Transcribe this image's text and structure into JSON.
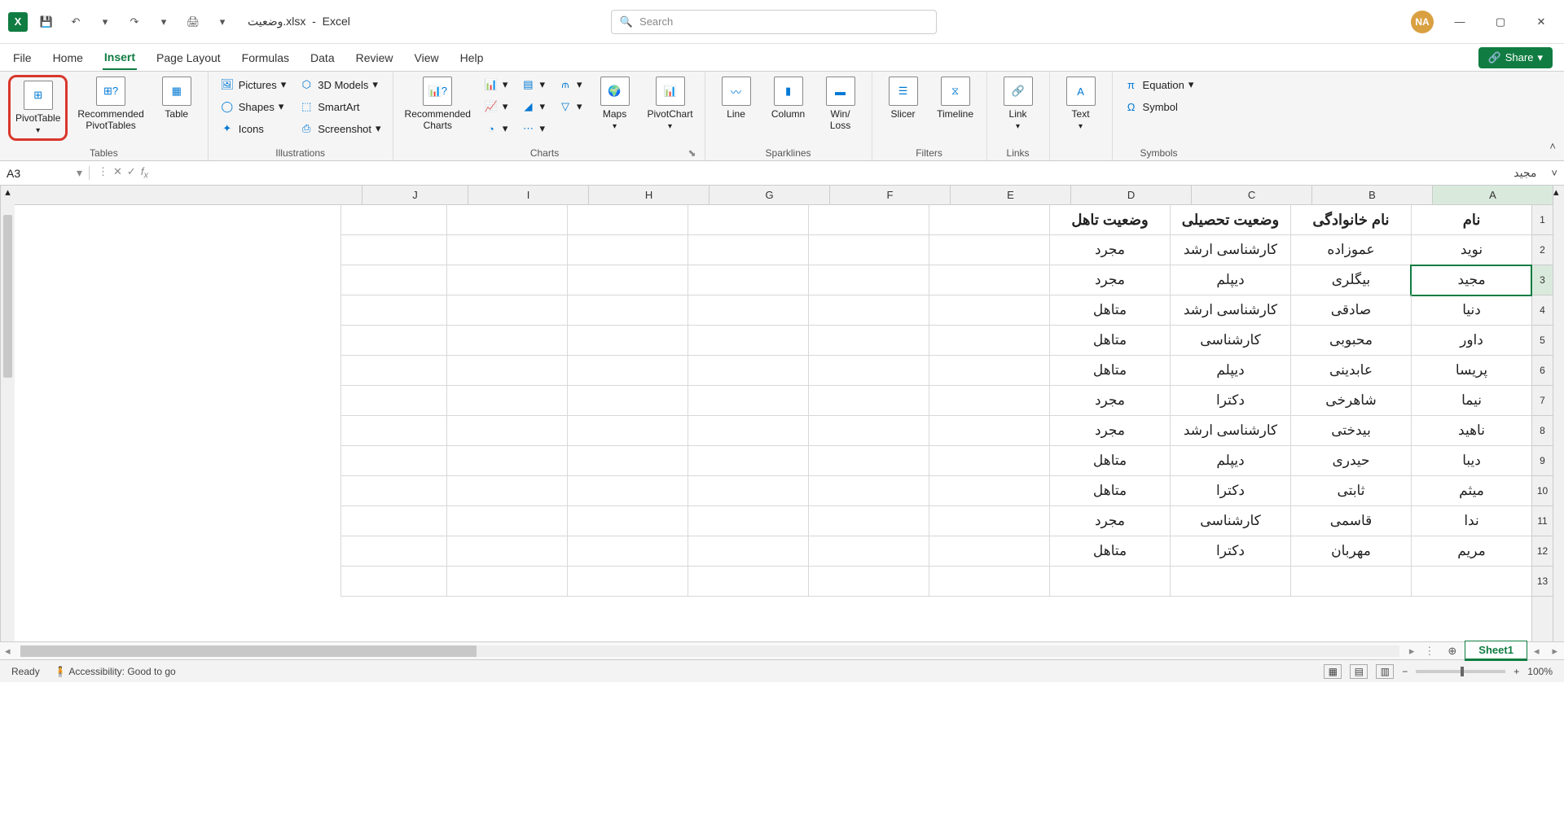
{
  "app": {
    "filename": "وضعیت.xlsx",
    "appname": "Excel",
    "avatar": "NA"
  },
  "search": {
    "placeholder": "Search"
  },
  "tabs": {
    "file": "File",
    "home": "Home",
    "insert": "Insert",
    "layout": "Page Layout",
    "formulas": "Formulas",
    "data": "Data",
    "review": "Review",
    "view": "View",
    "help": "Help",
    "share": "Share"
  },
  "ribbon": {
    "tables": {
      "pivot": "PivotTable",
      "recpivot": "Recommended\nPivotTables",
      "table": "Table",
      "group": "Tables"
    },
    "illus": {
      "pictures": "Pictures",
      "shapes": "Shapes",
      "icons": "Icons",
      "models": "3D Models",
      "smartart": "SmartArt",
      "screenshot": "Screenshot",
      "group": "Illustrations"
    },
    "charts": {
      "rec": "Recommended\nCharts",
      "maps": "Maps",
      "pivotchart": "PivotChart",
      "group": "Charts"
    },
    "spark": {
      "line": "Line",
      "col": "Column",
      "wl": "Win/\nLoss",
      "group": "Sparklines"
    },
    "filters": {
      "slicer": "Slicer",
      "timeline": "Timeline",
      "group": "Filters"
    },
    "links": {
      "link": "Link",
      "group": "Links"
    },
    "text": {
      "text": "Text",
      "group": ""
    },
    "symbols": {
      "eq": "Equation",
      "sym": "Symbol",
      "group": "Symbols"
    }
  },
  "namebox": "A3",
  "formula": "مجید",
  "columns": [
    "A",
    "B",
    "C",
    "D",
    "E",
    "F",
    "G",
    "H",
    "I",
    "J"
  ],
  "headers": {
    "A": "نام",
    "B": "نام خانوادگی",
    "C": "وضعیت تحصیلی",
    "D": "وضعیت تاهل"
  },
  "rows": [
    {
      "A": "نوید",
      "B": "عموزاده",
      "C": "کارشناسی ارشد",
      "D": "مجرد"
    },
    {
      "A": "مجید",
      "B": "بیگلری",
      "C": "دیپلم",
      "D": "مجرد"
    },
    {
      "A": "دنیا",
      "B": "صادقی",
      "C": "کارشناسی ارشد",
      "D": "متاهل"
    },
    {
      "A": "داور",
      "B": "محبوبی",
      "C": "کارشناسی",
      "D": "متاهل"
    },
    {
      "A": "پریسا",
      "B": "عابدینی",
      "C": "دیپلم",
      "D": "متاهل"
    },
    {
      "A": "نیما",
      "B": "شاهرخی",
      "C": "دکترا",
      "D": "مجرد"
    },
    {
      "A": "ناهید",
      "B": "بیدختی",
      "C": "کارشناسی ارشد",
      "D": "مجرد"
    },
    {
      "A": "دیبا",
      "B": "حیدری",
      "C": "دیپلم",
      "D": "متاهل"
    },
    {
      "A": "میثم",
      "B": "ثابتی",
      "C": "دکترا",
      "D": "متاهل"
    },
    {
      "A": "ندا",
      "B": "قاسمی",
      "C": "کارشناسی",
      "D": "مجرد"
    },
    {
      "A": "مریم",
      "B": "مهربان",
      "C": "دکترا",
      "D": "متاهل"
    }
  ],
  "sheet": "Sheet1",
  "status": {
    "ready": "Ready",
    "acc": "Accessibility: Good to go",
    "zoom": "100%"
  }
}
